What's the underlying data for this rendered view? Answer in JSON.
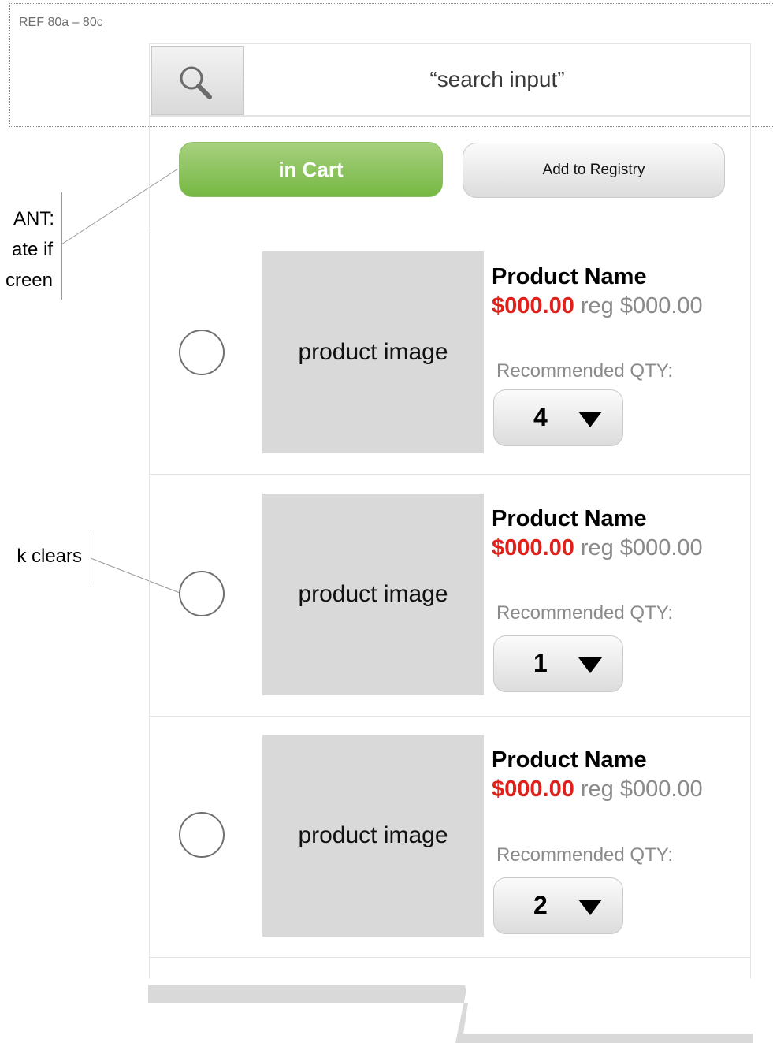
{
  "reference": {
    "label": "REF 80a – 80c"
  },
  "search": {
    "placeholder": "“search input”",
    "value": ""
  },
  "actions": {
    "in_cart": "in Cart",
    "add_to_registry": "Add to Registry"
  },
  "annotations": {
    "important": [
      "ANT:",
      "ate if",
      "creen"
    ],
    "radio_note": "k clears"
  },
  "products": [
    {
      "image_label": "product image",
      "name": "Product Name",
      "sale_price": "$000.00",
      "reg_price": "reg $000.00",
      "qty_label": "Recommended QTY:",
      "qty": "4"
    },
    {
      "image_label": "product image",
      "name": "Product Name",
      "sale_price": "$000.00",
      "reg_price": "reg $000.00",
      "qty_label": "Recommended QTY:",
      "qty": "1"
    },
    {
      "image_label": "product image",
      "name": "Product Name",
      "sale_price": "$000.00",
      "reg_price": "reg $000.00",
      "qty_label": "Recommended QTY:",
      "qty": "2"
    }
  ],
  "colors": {
    "cart_green": "#76b843",
    "sale_red": "#e0211b",
    "muted_gray": "#8a8a8a",
    "image_placeholder": "#d9d9d9"
  },
  "icons": [
    "search-icon",
    "chevron-down-icon"
  ]
}
